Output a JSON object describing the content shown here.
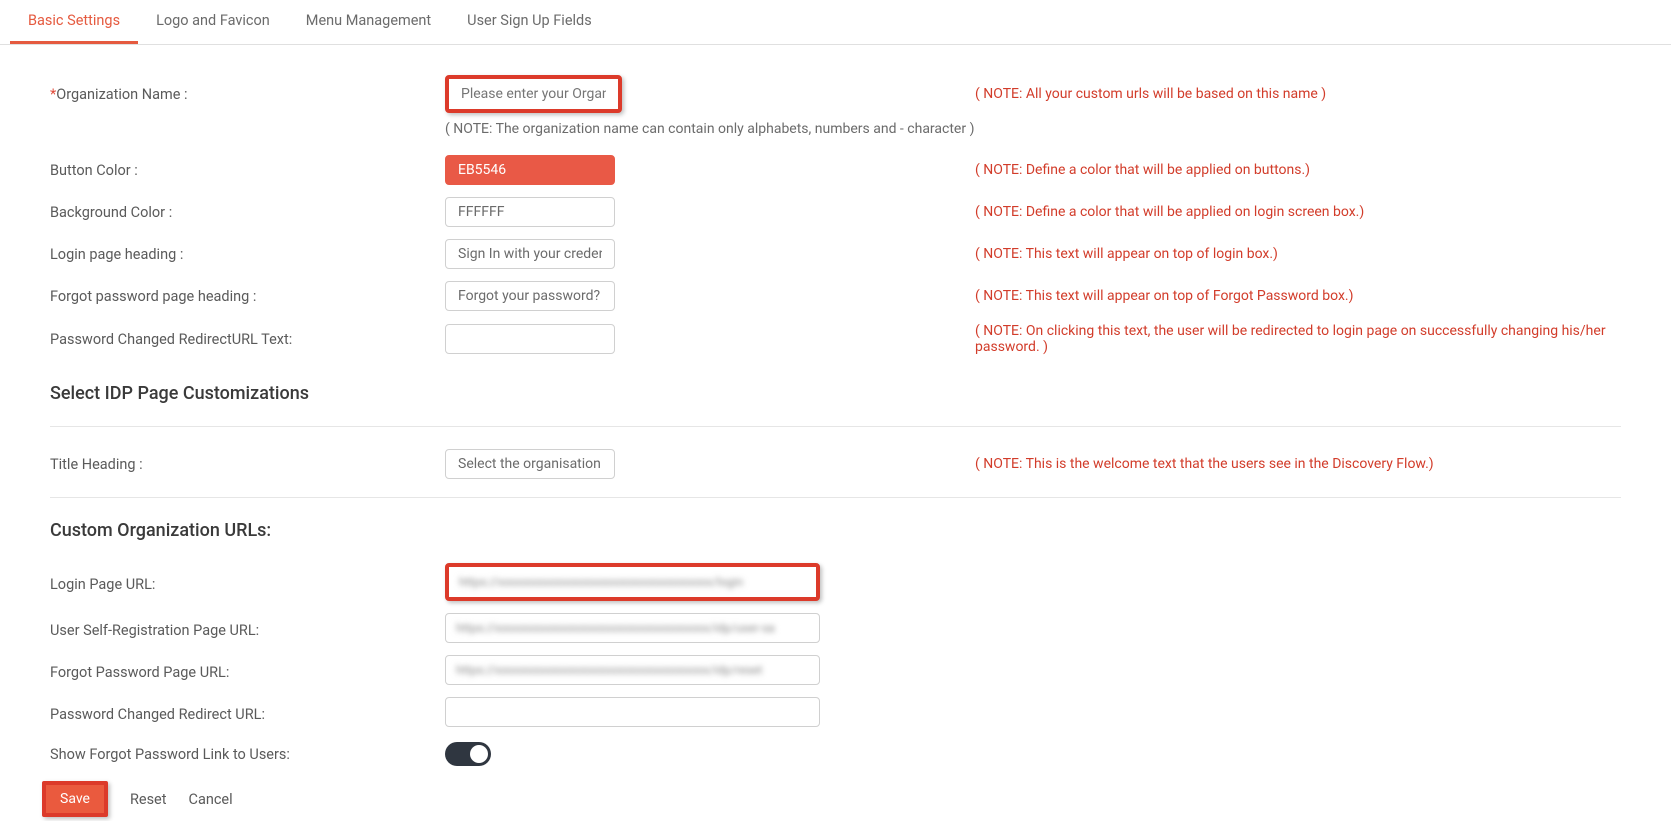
{
  "tabs": {
    "basic": "Basic Settings",
    "logo": "Logo and Favicon",
    "menu": "Menu Management",
    "signup": "User Sign Up Fields"
  },
  "fields": {
    "orgName": {
      "label": "Organization Name :",
      "placeholder": "Please enter your Organi",
      "note": "( NOTE: All your custom urls will be based on this name )",
      "subNote": "( NOTE: The organization name can contain only alphabets, numbers and - character )"
    },
    "buttonColor": {
      "label": "Button Color :",
      "value": "EB5546",
      "note": "( NOTE: Define a color that will be applied on buttons.)"
    },
    "bgColor": {
      "label": "Background Color :",
      "value": "FFFFFF",
      "note": "( NOTE: Define a color that will be applied on login screen box.)"
    },
    "loginHeading": {
      "label": "Login page heading :",
      "value": "Sign In with your credent",
      "note": "( NOTE: This text will appear on top of login box.)"
    },
    "forgotHeading": {
      "label": "Forgot password page heading :",
      "value": "Forgot your password?",
      "note": "( NOTE: This text will appear on top of Forgot Password box.)"
    },
    "pwdRedirectText": {
      "label": "Password Changed RedirectURL Text:",
      "value": "",
      "note": "( NOTE: On clicking this text, the user will be redirected to login page on successfully changing his/her password. )"
    },
    "titleHeading": {
      "label": "Title Heading :",
      "value": "Select the organisation y",
      "note": "( NOTE: This is the welcome text that the users see in the Discovery Flow.)"
    }
  },
  "sections": {
    "idp": "Select IDP Page Customizations",
    "urls": "Custom Organization URLs:"
  },
  "urls": {
    "loginPage": {
      "label": "Login Page URL:",
      "value": "https://xxxxxxxxxxxxxxxxxxxxxxxxxxxxxxxxxxxx/login"
    },
    "selfReg": {
      "label": "User Self-Registration Page URL:",
      "value": "https://xxxxxxxxxxxxxxxxxxxxxxxxxxxxxxxxxxxx/idp/user-sa"
    },
    "forgotPwd": {
      "label": "Forgot Password Page URL:",
      "value": "https://xxxxxxxxxxxxxxxxxxxxxxxxxxxxxxxxxxxx/idp/reset"
    },
    "pwdRedirect": {
      "label": "Password Changed Redirect URL:",
      "value": ""
    },
    "showForgot": {
      "label": "Show Forgot Password Link to Users:"
    }
  },
  "actions": {
    "save": "Save",
    "reset": "Reset",
    "cancel": "Cancel"
  }
}
